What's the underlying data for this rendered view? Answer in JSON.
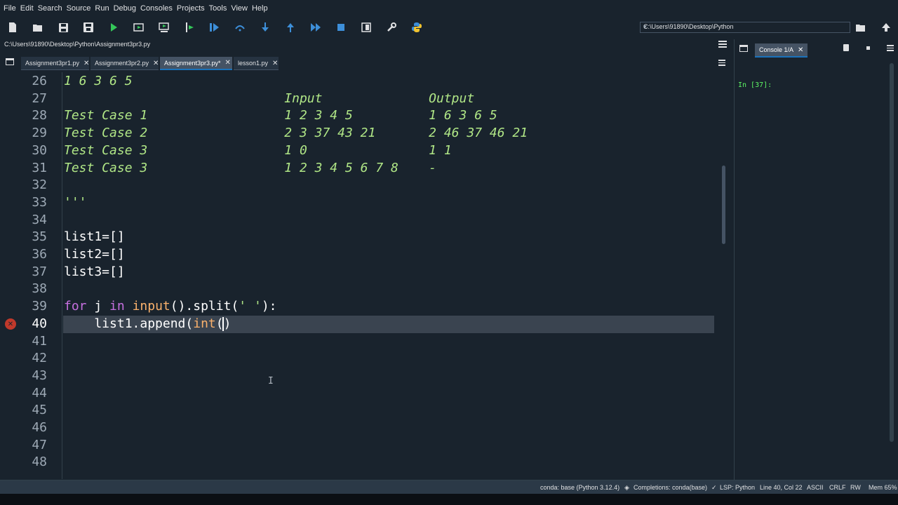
{
  "menu": [
    "File",
    "Edit",
    "Search",
    "Source",
    "Run",
    "Debug",
    "Consoles",
    "Projects",
    "Tools",
    "View",
    "Help"
  ],
  "toolbar": {
    "working_dir": "C:\\Users\\91890\\Desktop\\Python",
    "icons": [
      "new-file-icon",
      "open-file-icon",
      "save-icon",
      "save-all-icon",
      "run-icon",
      "run-cell-icon",
      "run-cell-advance-icon",
      "run-selection-icon",
      "debug-icon",
      "step-icon",
      "step-into-icon",
      "step-return-icon",
      "continue-icon",
      "stop-debug-icon",
      "maximize-pane-icon",
      "preferences-icon",
      "python-path-icon",
      "browse-folder-icon",
      "parent-dir-icon"
    ]
  },
  "editor": {
    "file_path": "C:\\Users\\91890\\Desktop\\Python\\Assignment3pr3.py",
    "tabs": [
      {
        "label": "Assignment3pr1.py"
      },
      {
        "label": "Assignment3pr2.py"
      },
      {
        "label": "Assignment3pr3.py*"
      },
      {
        "label": "lesson1.py"
      }
    ],
    "line_numbers": [
      "26",
      "27",
      "28",
      "29",
      "30",
      "31",
      "32",
      "33",
      "34",
      "35",
      "36",
      "37",
      "38",
      "39",
      "40",
      "41",
      "42",
      "43",
      "44",
      "45",
      "46",
      "47",
      "48"
    ],
    "lines": {
      "l26": "1 6 3 6 5",
      "l27": "                             Input              Output",
      "l28": "Test Case 1                  1 2 3 4 5          1 6 3 6 5",
      "l29": "Test Case 2                  2 3 37 43 21       2 46 37 46 21",
      "l30": "Test Case 3                  1 0                1 1",
      "l31": "Test Case 3                  1 2 3 4 5 6 7 8    -",
      "l33": "'''",
      "l35": "list1=[]",
      "l36": "list2=[]",
      "l37": "list3=[]",
      "l39_kw1": "for",
      "l39_mid": " j ",
      "l39_kw2": "in",
      "l39_bi": "input",
      "l39_rest1": "().split(",
      "l39_str": "' '",
      "l39_rest2": "):",
      "l40_pre": "    list1.append(",
      "l40_bi": "int",
      "l40_open": "(",
      "l40_close": ")"
    }
  },
  "console": {
    "tab_label": "Console 1/A",
    "prompt": "In [37]:"
  },
  "status": {
    "env": "conda: base (Python 3.12.4)",
    "completions": "Completions: conda(base)",
    "lsp": "LSP: Python",
    "position": "Line 40, Col 22",
    "encoding": "ASCII",
    "eol": "CRLF",
    "mode": "RW",
    "memory": "Mem 65%"
  },
  "colors": {
    "background": "#19232d",
    "string": "#b0e686",
    "keyword": "#c670e0",
    "builtin": "#fab16c",
    "prompt": "#5df563",
    "accent": "#1a72bb"
  }
}
